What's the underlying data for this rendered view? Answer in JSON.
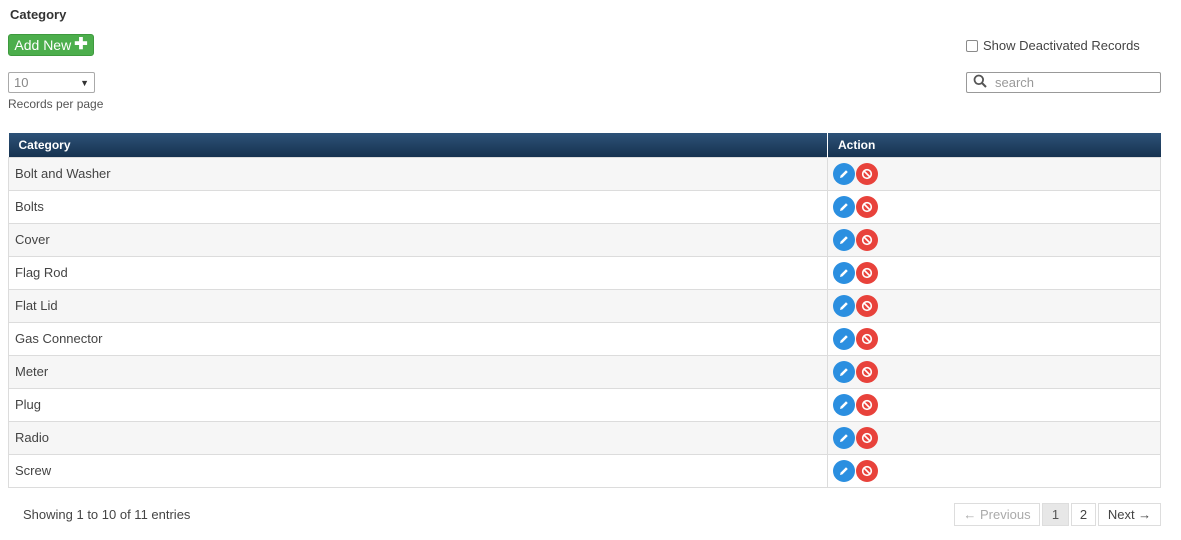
{
  "header": {
    "title": "Category"
  },
  "toolbar": {
    "add_label": "Add New",
    "add_icon": "plus-icon",
    "show_deactivated_label": "Show Deactivated Records",
    "show_deactivated_checked": false
  },
  "page_size": {
    "value": "10",
    "label": "Records per page"
  },
  "search": {
    "placeholder": "search",
    "icon": "search-icon"
  },
  "table": {
    "columns": [
      "Category",
      "Action"
    ],
    "rows": [
      {
        "category": "Bolt and Washer"
      },
      {
        "category": "Bolts"
      },
      {
        "category": "Cover"
      },
      {
        "category": "Flag Rod"
      },
      {
        "category": "Flat Lid"
      },
      {
        "category": "Gas Connector"
      },
      {
        "category": "Meter"
      },
      {
        "category": "Plug"
      },
      {
        "category": "Radio"
      },
      {
        "category": "Screw"
      }
    ],
    "action_icons": [
      "edit-icon",
      "deactivate-icon"
    ]
  },
  "footer": {
    "info": "Showing 1 to 10 of 11 entries",
    "prev_label": "← Previous",
    "pages": [
      "1",
      "2"
    ],
    "current_page": "1",
    "next_label": "Next →"
  },
  "colors": {
    "add_button": "#4cae4c",
    "header_bg": "#1f3d5e",
    "edit_icon": "#2b8fe0",
    "deactivate_icon": "#e8423b"
  }
}
